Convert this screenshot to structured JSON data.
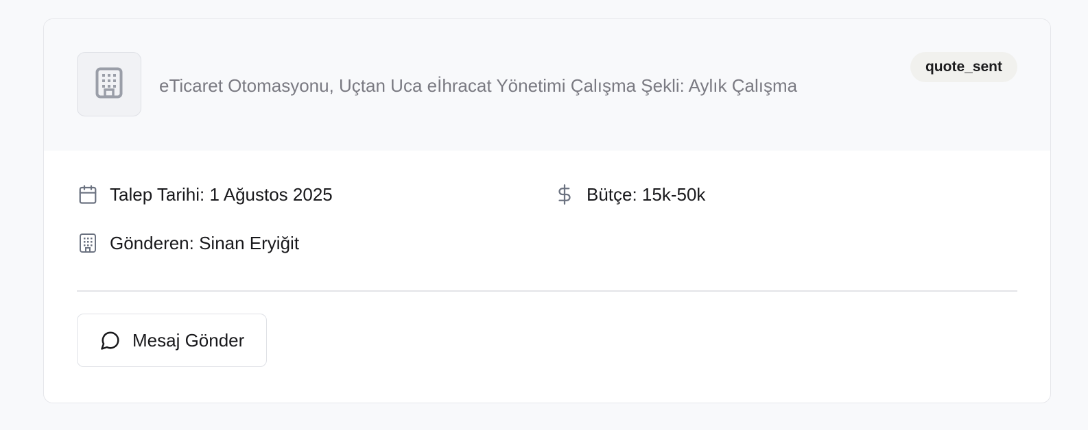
{
  "header": {
    "logo_icon": "building-icon",
    "description": "eTicaret Otomasyonu, Uçtan Uca eİhracat Yönetimi Çalışma Şekli: Aylık Çalışma",
    "status": "quote_sent"
  },
  "details": {
    "date": {
      "icon": "calendar-icon",
      "label": "Talep Tarihi: 1 Ağustos 2025"
    },
    "budget": {
      "icon": "dollar-icon",
      "label": "Bütçe: 15k-50k"
    },
    "sender": {
      "icon": "building-icon",
      "label": "Gönderen: Sinan Eryiğit"
    }
  },
  "actions": {
    "message": {
      "icon": "message-circle-icon",
      "label": "Mesaj Gönder"
    }
  },
  "colors": {
    "icon_gray": "#6b7280",
    "badge_bg": "#f1f1ee",
    "header_bg": "#f8f9fb"
  }
}
